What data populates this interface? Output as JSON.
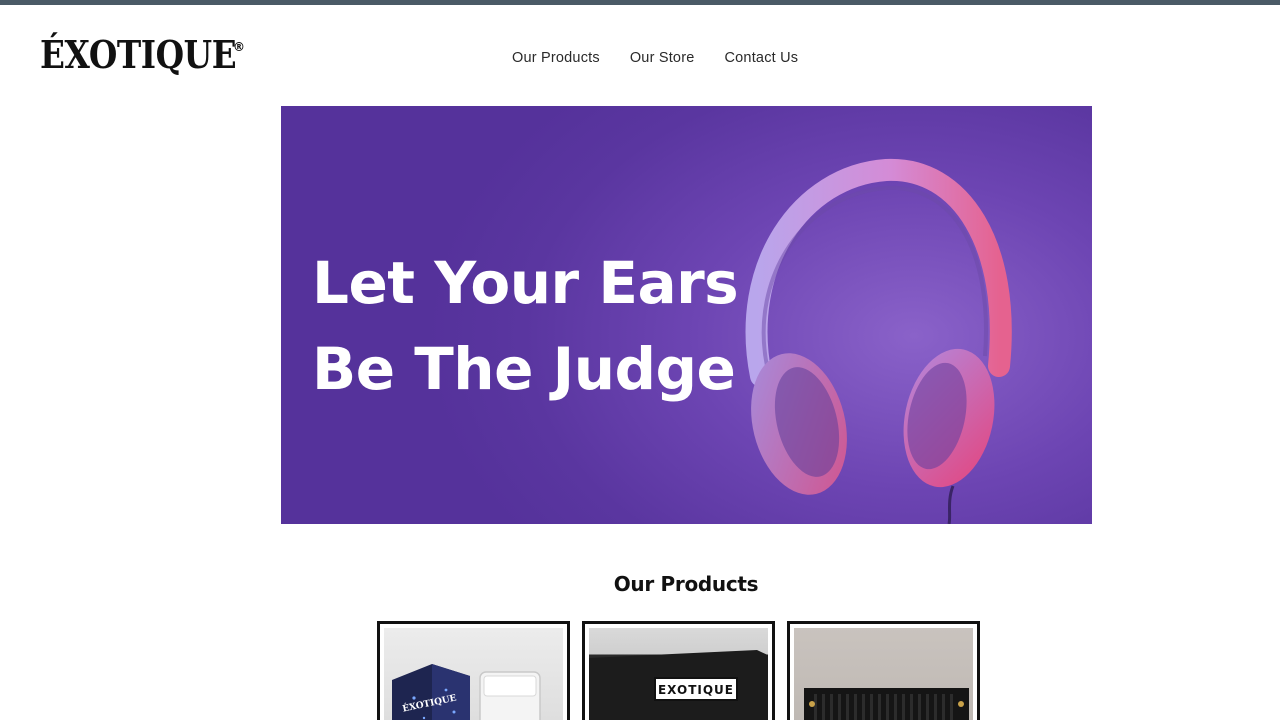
{
  "brand": {
    "name": "ÉXOTIQUE",
    "registered": "®"
  },
  "nav": {
    "items": [
      {
        "label": "Our Products"
      },
      {
        "label": "Our Store"
      },
      {
        "label": "Contact Us"
      }
    ]
  },
  "hero": {
    "headline_line1": "Let Your Ears",
    "headline_line2": "Be The Judge",
    "background_color": "#6a44b0",
    "image": "headphones"
  },
  "products": {
    "title": "Our Products",
    "items": [
      {
        "image": "earplug-box-product",
        "box_label": "ÉXOTIQUE"
      },
      {
        "image": "black-amplifier-product",
        "box_label": "EXOTIQUE"
      },
      {
        "image": "amplifier-rear-panel-product"
      }
    ]
  },
  "colors": {
    "top_bar": "#4a5a66",
    "hero_purple": "#6a44b0",
    "card_border": "#111111"
  }
}
